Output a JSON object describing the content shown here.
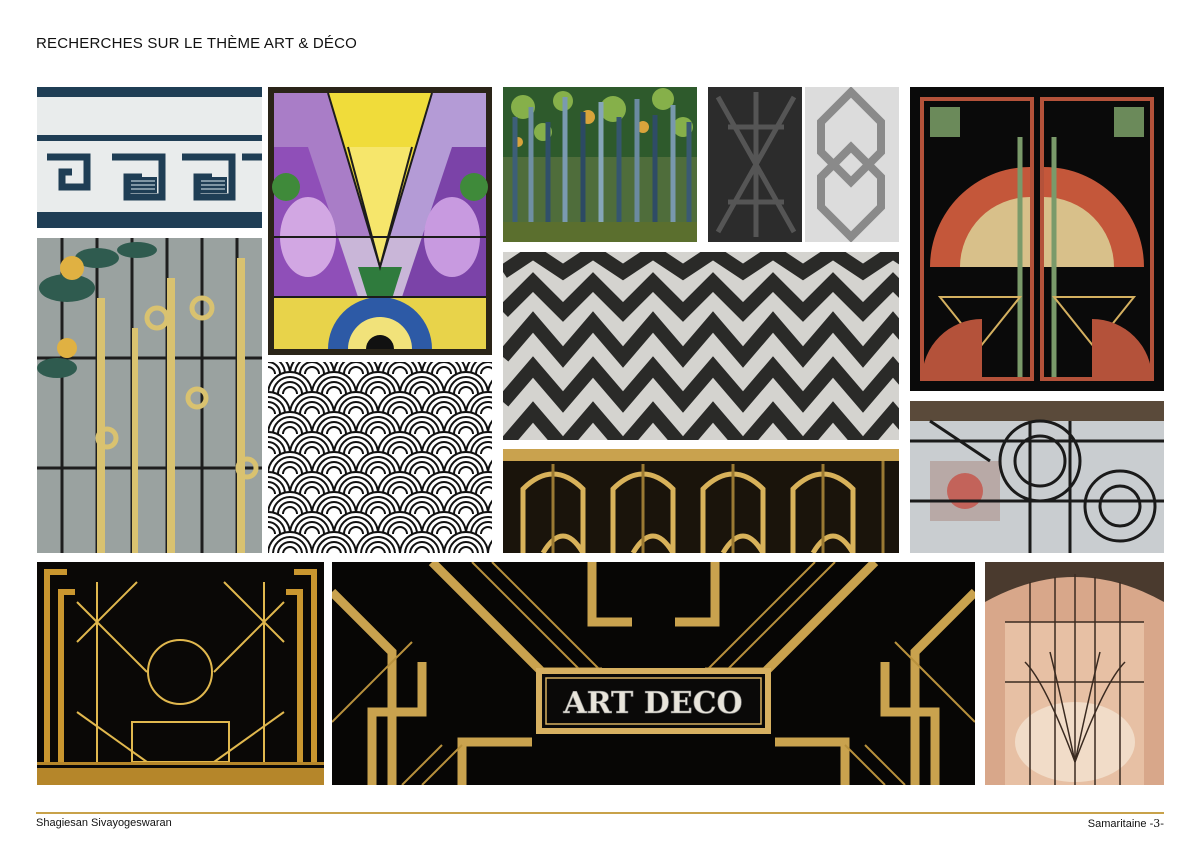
{
  "page": {
    "title": "RECHERCHES SUR LE THÈME ART & DÉCO",
    "author": "Shagiesan Sivayogeswaran",
    "project": "Samaritaine",
    "page_number": "-3-"
  },
  "banner": {
    "text": "ART DECO"
  },
  "colors": {
    "gold": "#c9a24e",
    "accent_line": "#c8a24a",
    "black": "#0a0a0a"
  }
}
